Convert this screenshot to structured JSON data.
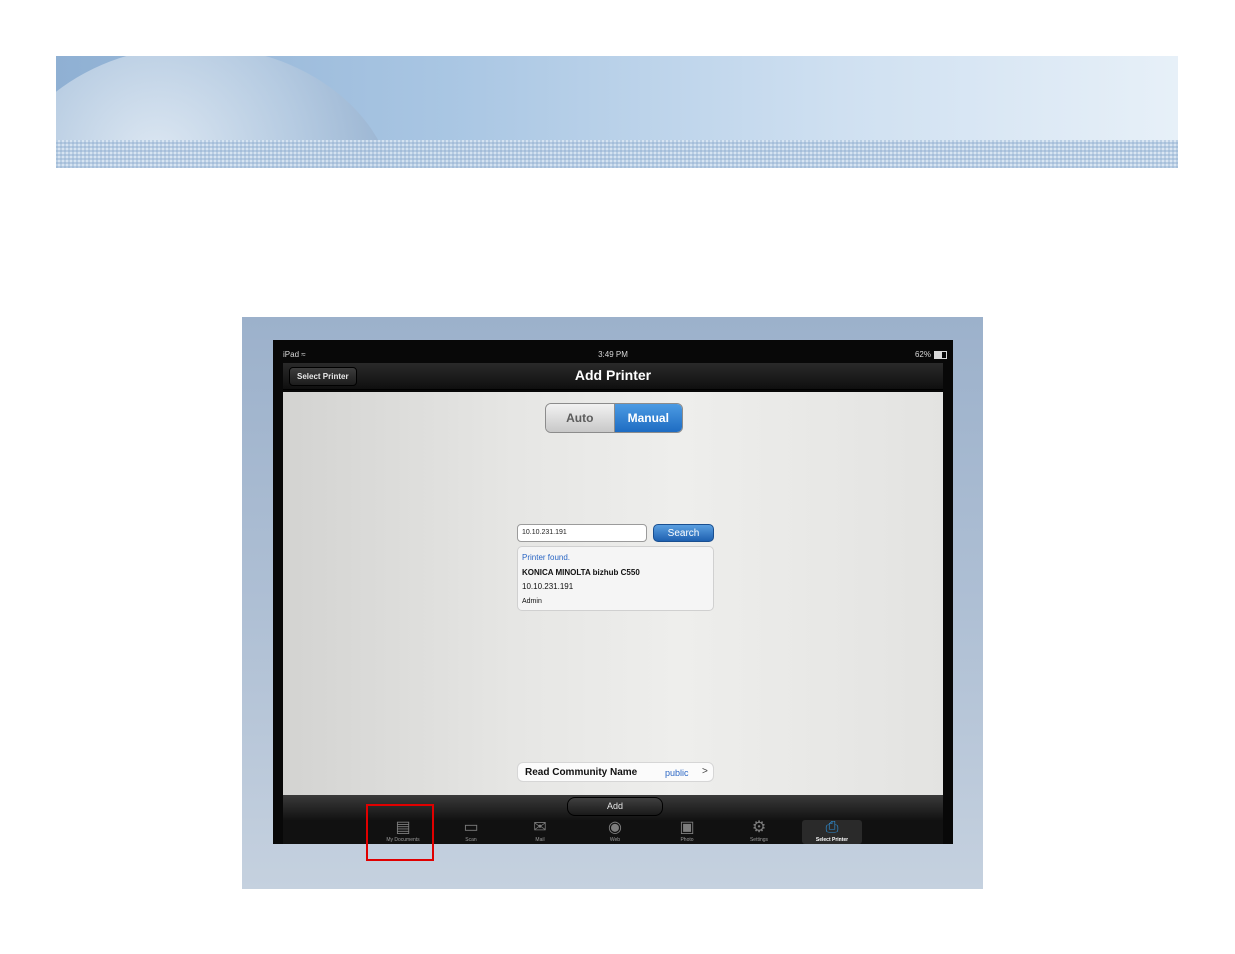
{
  "status_bar": {
    "device": "iPad",
    "wifi_icon": "wifi-icon",
    "time": "3:49 PM",
    "battery": "62%"
  },
  "nav_bar": {
    "back_label": "Select Printer",
    "title": "Add Printer"
  },
  "segment": {
    "options": [
      "Auto",
      "Manual"
    ],
    "selected": "Manual"
  },
  "search": {
    "ip_value": "10.10.231.191",
    "button_label": "Search"
  },
  "result": {
    "status": "Printer found.",
    "model": "KONICA MINOLTA bizhub C550",
    "ip": "10.10.231.191",
    "user": "Admin"
  },
  "community": {
    "label": "Read Community Name",
    "value": "public",
    "chevron": ">"
  },
  "toolbar": {
    "add_label": "Add"
  },
  "tab_bar": {
    "selected": "Select Printer",
    "items": [
      {
        "label": "My Documents",
        "icon": "documents-icon"
      },
      {
        "label": "Scan",
        "icon": "scan-icon"
      },
      {
        "label": "Mail",
        "icon": "mail-icon"
      },
      {
        "label": "Web",
        "icon": "globe-icon"
      },
      {
        "label": "Photo",
        "icon": "photo-icon"
      },
      {
        "label": "Settings",
        "icon": "gear-icon"
      },
      {
        "label": "Select Printer",
        "icon": "printer-icon"
      }
    ]
  },
  "colors": {
    "accent": "#1e6cc2",
    "highlight_box": "#e00000",
    "tab_selected": "#2f8fd6"
  }
}
